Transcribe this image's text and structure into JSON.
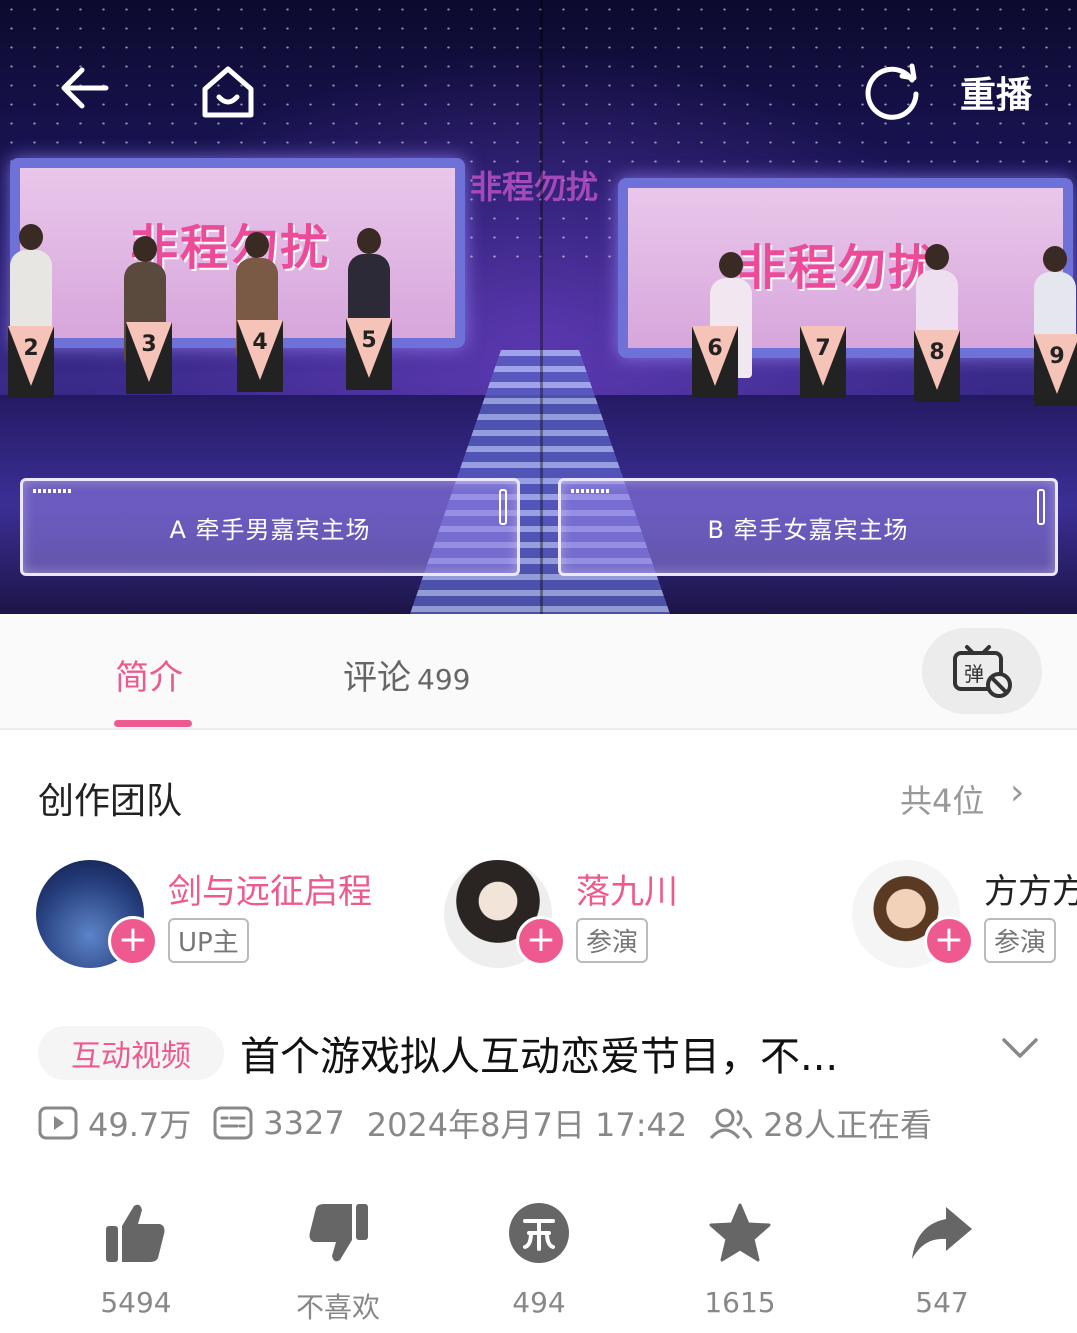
{
  "player": {
    "replay_label": "重播",
    "choices": [
      {
        "label": "A 牵手男嘉宾主场"
      },
      {
        "label": "B 牵手女嘉宾主场"
      }
    ],
    "podium_numbers_left": [
      "2",
      "3",
      "4",
      "5"
    ],
    "podium_numbers_right": [
      "6",
      "7",
      "8",
      "9"
    ],
    "stage_logo_text": "非程勿扰"
  },
  "tabs": {
    "intro_label": "简介",
    "comments_label": "评论",
    "comments_count": "499",
    "danmaku_icon": "danmaku-off-icon"
  },
  "team": {
    "title": "创作团队",
    "count_label": "共4位",
    "members": [
      {
        "name": "剑与远征启程",
        "role": "UP主"
      },
      {
        "name": "落九川",
        "role": "参演"
      },
      {
        "name": "方方方",
        "role": "参演"
      }
    ]
  },
  "video": {
    "badge": "互动视频",
    "title": "首个游戏拟人互动恋爱节目，不...",
    "views": "49.7万",
    "danmaku_count": "3327",
    "date": "2024年8月7日 17:42",
    "watching": "28人正在看"
  },
  "actions": {
    "like": "5494",
    "dislike": "不喜欢",
    "coin": "494",
    "favorite": "1615",
    "share": "547"
  },
  "colors": {
    "accent": "#ee5a8f",
    "icon_gray": "#666666",
    "muted_text": "#888888"
  }
}
